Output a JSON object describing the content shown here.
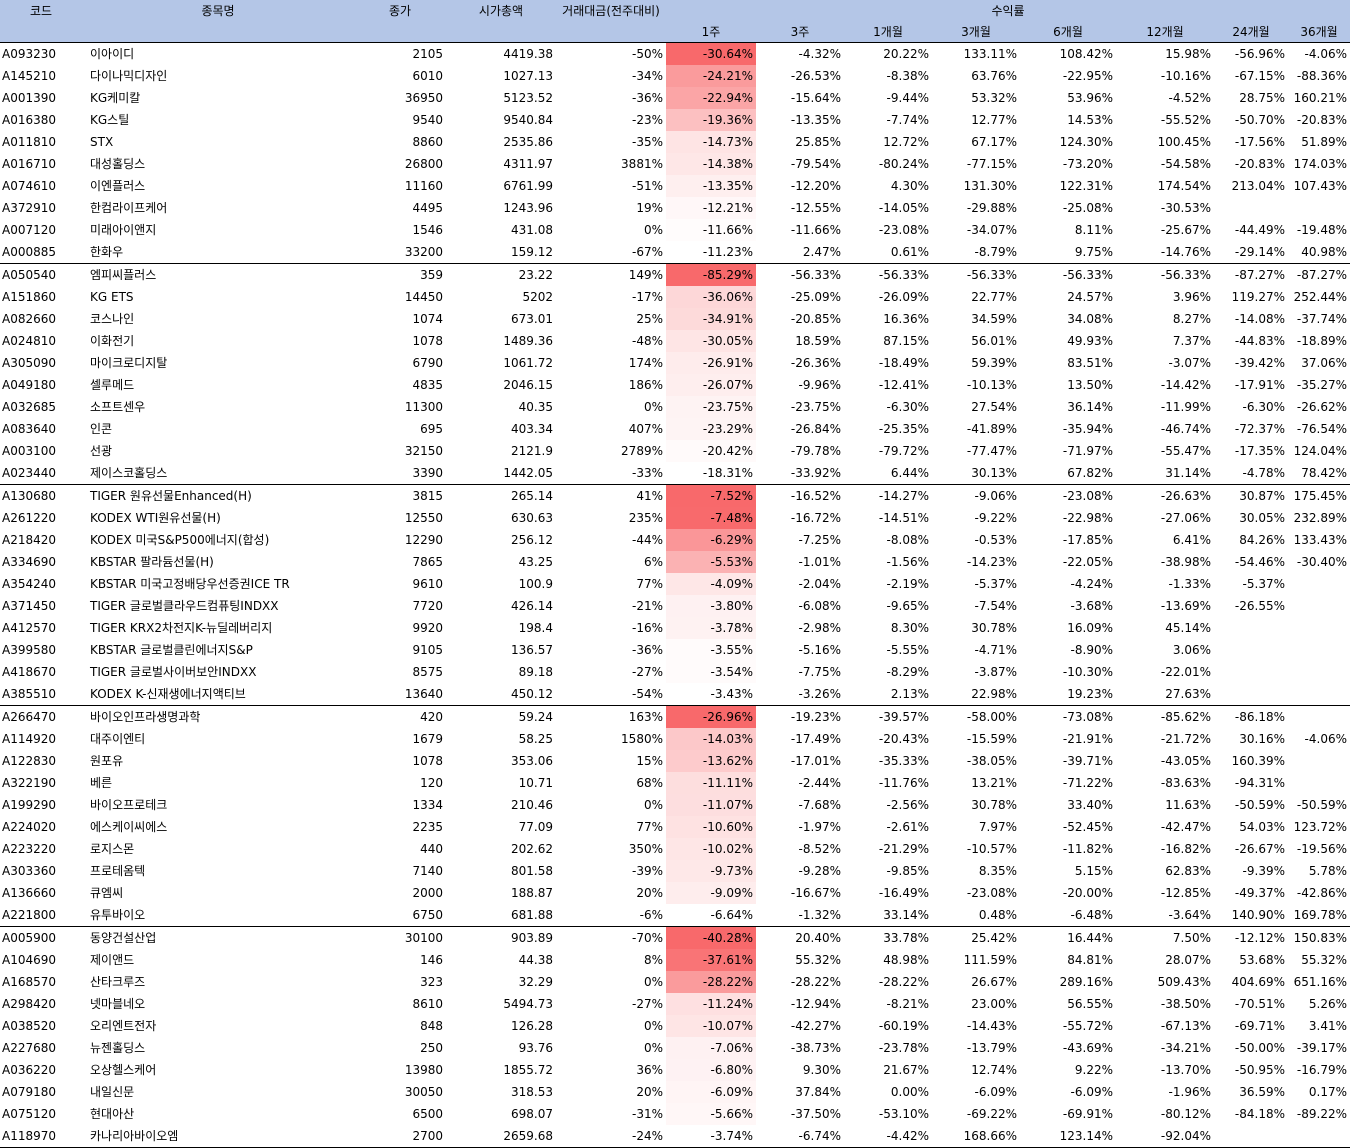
{
  "header": {
    "code": "코드",
    "name": "종목명",
    "close": "종가",
    "mktcap": "시가총액",
    "turnover": "거래대금(전주대비)",
    "return_group": "수익률",
    "periods": [
      "1주",
      "3주",
      "1개월",
      "3개월",
      "6개월",
      "12개월",
      "24개월",
      "36개월"
    ]
  },
  "colors": {
    "header_bg": "#b4c6e7",
    "heat_max": "#f8696b",
    "heat_min": "#ffffff"
  },
  "groups": [
    [
      [
        "A093230",
        "이아이디",
        "2105",
        "4419.38",
        "-50%",
        "-30.64%",
        "-4.32%",
        "20.22%",
        "133.11%",
        "108.42%",
        "15.98%",
        "-56.96%",
        "-4.06%"
      ],
      [
        "A145210",
        "다이나믹디자인",
        "6010",
        "1027.13",
        "-34%",
        "-24.21%",
        "-26.53%",
        "-8.38%",
        "63.76%",
        "-22.95%",
        "-10.16%",
        "-67.15%",
        "-88.36%"
      ],
      [
        "A001390",
        "KG케미칼",
        "36950",
        "5123.52",
        "-36%",
        "-22.94%",
        "-15.64%",
        "-9.44%",
        "53.32%",
        "53.96%",
        "-4.52%",
        "28.75%",
        "160.21%"
      ],
      [
        "A016380",
        "KG스틸",
        "9540",
        "9540.84",
        "-23%",
        "-19.36%",
        "-13.35%",
        "-7.74%",
        "12.77%",
        "14.53%",
        "-55.52%",
        "-50.70%",
        "-20.83%"
      ],
      [
        "A011810",
        "STX",
        "8860",
        "2535.86",
        "-35%",
        "-14.73%",
        "25.85%",
        "12.72%",
        "67.17%",
        "124.30%",
        "100.45%",
        "-17.56%",
        "51.89%"
      ],
      [
        "A016710",
        "대성홀딩스",
        "26800",
        "4311.97",
        "3881%",
        "-14.38%",
        "-79.54%",
        "-80.24%",
        "-77.15%",
        "-73.20%",
        "-54.58%",
        "-20.83%",
        "174.03%"
      ],
      [
        "A074610",
        "이엔플러스",
        "11160",
        "6761.99",
        "-51%",
        "-13.35%",
        "-12.20%",
        "4.30%",
        "131.30%",
        "122.31%",
        "174.54%",
        "213.04%",
        "107.43%"
      ],
      [
        "A372910",
        "한컴라이프케어",
        "4495",
        "1243.96",
        "19%",
        "-12.21%",
        "-12.55%",
        "-14.05%",
        "-29.88%",
        "-25.08%",
        "-30.53%",
        "",
        ""
      ],
      [
        "A007120",
        "미래아이앤지",
        "1546",
        "431.08",
        "0%",
        "-11.66%",
        "-11.66%",
        "-23.08%",
        "-34.07%",
        "8.11%",
        "-25.67%",
        "-44.49%",
        "-19.48%"
      ],
      [
        "A000885",
        "한화우",
        "33200",
        "159.12",
        "-67%",
        "-11.23%",
        "2.47%",
        "0.61%",
        "-8.79%",
        "9.75%",
        "-14.76%",
        "-29.14%",
        "40.98%"
      ]
    ],
    [
      [
        "A050540",
        "엠피씨플러스",
        "359",
        "23.22",
        "149%",
        "-85.29%",
        "-56.33%",
        "-56.33%",
        "-56.33%",
        "-56.33%",
        "-56.33%",
        "-87.27%",
        "-87.27%"
      ],
      [
        "A151860",
        "KG ETS",
        "14450",
        "5202",
        "-17%",
        "-36.06%",
        "-25.09%",
        "-26.09%",
        "22.77%",
        "24.57%",
        "3.96%",
        "119.27%",
        "252.44%"
      ],
      [
        "A082660",
        "코스나인",
        "1074",
        "673.01",
        "25%",
        "-34.91%",
        "-20.85%",
        "16.36%",
        "34.59%",
        "34.08%",
        "8.27%",
        "-14.08%",
        "-37.74%"
      ],
      [
        "A024810",
        "이화전기",
        "1078",
        "1489.36",
        "-48%",
        "-30.05%",
        "18.59%",
        "87.15%",
        "56.01%",
        "49.93%",
        "7.37%",
        "-44.83%",
        "-18.89%"
      ],
      [
        "A305090",
        "마이크로디지탈",
        "6790",
        "1061.72",
        "174%",
        "-26.91%",
        "-26.36%",
        "-18.49%",
        "59.39%",
        "83.51%",
        "-3.07%",
        "-39.42%",
        "37.06%"
      ],
      [
        "A049180",
        "셀루메드",
        "4835",
        "2046.15",
        "186%",
        "-26.07%",
        "-9.96%",
        "-12.41%",
        "-10.13%",
        "13.50%",
        "-14.42%",
        "-17.91%",
        "-35.27%"
      ],
      [
        "A032685",
        "소프트센우",
        "11300",
        "40.35",
        "0%",
        "-23.75%",
        "-23.75%",
        "-6.30%",
        "27.54%",
        "36.14%",
        "-11.99%",
        "-6.30%",
        "-26.62%"
      ],
      [
        "A083640",
        "인콘",
        "695",
        "403.34",
        "407%",
        "-23.29%",
        "-26.84%",
        "-25.35%",
        "-41.89%",
        "-35.94%",
        "-46.74%",
        "-72.37%",
        "-76.54%"
      ],
      [
        "A003100",
        "선광",
        "32150",
        "2121.9",
        "2789%",
        "-20.42%",
        "-79.78%",
        "-79.72%",
        "-77.47%",
        "-71.97%",
        "-55.47%",
        "-17.35%",
        "124.04%"
      ],
      [
        "A023440",
        "제이스코홀딩스",
        "3390",
        "1442.05",
        "-33%",
        "-18.31%",
        "-33.92%",
        "6.44%",
        "30.13%",
        "67.82%",
        "31.14%",
        "-4.78%",
        "78.42%"
      ]
    ],
    [
      [
        "A130680",
        "TIGER 원유선물Enhanced(H)",
        "3815",
        "265.14",
        "41%",
        "-7.52%",
        "-16.52%",
        "-14.27%",
        "-9.06%",
        "-23.08%",
        "-26.63%",
        "30.87%",
        "175.45%"
      ],
      [
        "A261220",
        "KODEX WTI원유선물(H)",
        "12550",
        "630.63",
        "235%",
        "-7.48%",
        "-16.72%",
        "-14.51%",
        "-9.22%",
        "-22.98%",
        "-27.06%",
        "30.05%",
        "232.89%"
      ],
      [
        "A218420",
        "KODEX 미국S&P500에너지(합성)",
        "12290",
        "256.12",
        "-44%",
        "-6.29%",
        "-7.25%",
        "-8.08%",
        "-0.53%",
        "-17.85%",
        "6.41%",
        "84.26%",
        "133.43%"
      ],
      [
        "A334690",
        "KBSTAR 팔라듐선물(H)",
        "7865",
        "43.25",
        "6%",
        "-5.53%",
        "-1.01%",
        "-1.56%",
        "-14.23%",
        "-22.05%",
        "-38.98%",
        "-54.46%",
        "-30.40%"
      ],
      [
        "A354240",
        "KBSTAR 미국고정배당우선증권ICE TR",
        "9610",
        "100.9",
        "77%",
        "-4.09%",
        "-2.04%",
        "-2.19%",
        "-5.37%",
        "-4.24%",
        "-1.33%",
        "-5.37%",
        ""
      ],
      [
        "A371450",
        "TIGER 글로벌클라우드컴퓨팅INDXX",
        "7720",
        "426.14",
        "-21%",
        "-3.80%",
        "-6.08%",
        "-9.65%",
        "-7.54%",
        "-3.68%",
        "-13.69%",
        "-26.55%",
        ""
      ],
      [
        "A412570",
        "TIGER KRX2차전지K-뉴딜레버리지",
        "9920",
        "198.4",
        "-16%",
        "-3.78%",
        "-2.98%",
        "8.30%",
        "30.78%",
        "16.09%",
        "45.14%",
        "",
        ""
      ],
      [
        "A399580",
        "KBSTAR 글로벌클린에너지S&P",
        "9105",
        "136.57",
        "-36%",
        "-3.55%",
        "-5.16%",
        "-5.55%",
        "-4.71%",
        "-8.90%",
        "3.06%",
        "",
        ""
      ],
      [
        "A418670",
        "TIGER 글로벌사이버보안INDXX",
        "8575",
        "89.18",
        "-27%",
        "-3.54%",
        "-7.75%",
        "-8.29%",
        "-3.87%",
        "-10.30%",
        "-22.01%",
        "",
        ""
      ],
      [
        "A385510",
        "KODEX K-신재생에너지액티브",
        "13640",
        "450.12",
        "-54%",
        "-3.43%",
        "-3.26%",
        "2.13%",
        "22.98%",
        "19.23%",
        "27.63%",
        "",
        ""
      ]
    ],
    [
      [
        "A266470",
        "바이오인프라생명과학",
        "420",
        "59.24",
        "163%",
        "-26.96%",
        "-19.23%",
        "-39.57%",
        "-58.00%",
        "-73.08%",
        "-85.62%",
        "-86.18%",
        ""
      ],
      [
        "A114920",
        "대주이엔티",
        "1679",
        "58.25",
        "1580%",
        "-14.03%",
        "-17.49%",
        "-20.43%",
        "-15.59%",
        "-21.91%",
        "-21.72%",
        "30.16%",
        "-4.06%"
      ],
      [
        "A122830",
        "원포유",
        "1078",
        "353.06",
        "15%",
        "-13.62%",
        "-17.01%",
        "-35.33%",
        "-38.05%",
        "-39.71%",
        "-43.05%",
        "160.39%",
        ""
      ],
      [
        "A322190",
        "베른",
        "120",
        "10.71",
        "68%",
        "-11.11%",
        "-2.44%",
        "-11.76%",
        "13.21%",
        "-71.22%",
        "-83.63%",
        "-94.31%",
        ""
      ],
      [
        "A199290",
        "바이오프로테크",
        "1334",
        "210.46",
        "0%",
        "-11.07%",
        "-7.68%",
        "-2.56%",
        "30.78%",
        "33.40%",
        "11.63%",
        "-50.59%",
        "-50.59%"
      ],
      [
        "A224020",
        "에스케이씨에스",
        "2235",
        "77.09",
        "77%",
        "-10.60%",
        "-1.97%",
        "-2.61%",
        "7.97%",
        "-52.45%",
        "-42.47%",
        "54.03%",
        "123.72%"
      ],
      [
        "A223220",
        "로지스몬",
        "440",
        "202.62",
        "350%",
        "-10.02%",
        "-8.52%",
        "-21.29%",
        "-10.57%",
        "-11.82%",
        "-16.82%",
        "-26.67%",
        "-19.56%"
      ],
      [
        "A303360",
        "프로테옴텍",
        "7140",
        "801.58",
        "-39%",
        "-9.73%",
        "-9.28%",
        "-9.85%",
        "8.35%",
        "5.15%",
        "62.83%",
        "-9.39%",
        "5.78%"
      ],
      [
        "A136660",
        "큐엠씨",
        "2000",
        "188.87",
        "20%",
        "-9.09%",
        "-16.67%",
        "-16.49%",
        "-23.08%",
        "-20.00%",
        "-12.85%",
        "-49.37%",
        "-42.86%"
      ],
      [
        "A221800",
        "유투바이오",
        "6750",
        "681.88",
        "-6%",
        "-6.64%",
        "-1.32%",
        "33.14%",
        "0.48%",
        "-6.48%",
        "-3.64%",
        "140.90%",
        "169.78%"
      ]
    ],
    [
      [
        "A005900",
        "동양건설산업",
        "30100",
        "903.89",
        "-70%",
        "-40.28%",
        "20.40%",
        "33.78%",
        "25.42%",
        "16.44%",
        "7.50%",
        "-12.12%",
        "150.83%"
      ],
      [
        "A104690",
        "제이앤드",
        "146",
        "44.38",
        "8%",
        "-37.61%",
        "55.32%",
        "48.98%",
        "111.59%",
        "84.81%",
        "28.07%",
        "53.68%",
        "55.32%"
      ],
      [
        "A168570",
        "산타크루즈",
        "323",
        "32.29",
        "0%",
        "-28.22%",
        "-28.22%",
        "-28.22%",
        "26.67%",
        "289.16%",
        "509.43%",
        "404.69%",
        "651.16%"
      ],
      [
        "A298420",
        "넷마블네오",
        "8610",
        "5494.73",
        "-27%",
        "-11.24%",
        "-12.94%",
        "-8.21%",
        "23.00%",
        "56.55%",
        "-38.50%",
        "-70.51%",
        "5.26%"
      ],
      [
        "A038520",
        "오리엔트전자",
        "848",
        "126.28",
        "0%",
        "-10.07%",
        "-42.27%",
        "-60.19%",
        "-14.43%",
        "-55.72%",
        "-67.13%",
        "-69.71%",
        "3.41%"
      ],
      [
        "A227680",
        "뉴젠홀딩스",
        "250",
        "93.76",
        "0%",
        "-7.06%",
        "-38.73%",
        "-23.78%",
        "-13.79%",
        "-43.69%",
        "-34.21%",
        "-50.00%",
        "-39.17%"
      ],
      [
        "A036220",
        "오상헬스케어",
        "13980",
        "1855.72",
        "36%",
        "-6.80%",
        "9.30%",
        "21.67%",
        "12.74%",
        "9.22%",
        "-13.70%",
        "-50.95%",
        "-16.79%"
      ],
      [
        "A079180",
        "내일신문",
        "30050",
        "318.53",
        "20%",
        "-6.09%",
        "37.84%",
        "0.00%",
        "-6.09%",
        "-6.09%",
        "-1.96%",
        "36.59%",
        "0.17%"
      ],
      [
        "A075120",
        "현대아산",
        "6500",
        "698.07",
        "-31%",
        "-5.66%",
        "-37.50%",
        "-53.10%",
        "-69.22%",
        "-69.91%",
        "-80.12%",
        "-84.18%",
        "-89.22%"
      ],
      [
        "A118970",
        "카나리아바이오엠",
        "2700",
        "2659.68",
        "-24%",
        "-3.74%",
        "-6.74%",
        "-4.42%",
        "168.66%",
        "123.14%",
        "-92.04%",
        "",
        ""
      ]
    ]
  ]
}
